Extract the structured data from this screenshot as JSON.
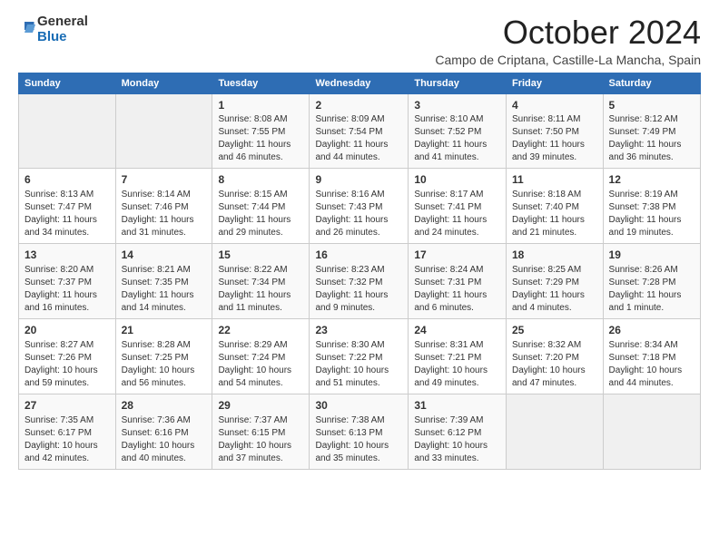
{
  "logo": {
    "line1": "General",
    "line2": "Blue"
  },
  "title": "October 2024",
  "location": "Campo de Criptana, Castille-La Mancha, Spain",
  "days_of_week": [
    "Sunday",
    "Monday",
    "Tuesday",
    "Wednesday",
    "Thursday",
    "Friday",
    "Saturday"
  ],
  "weeks": [
    [
      {
        "day": "",
        "info": ""
      },
      {
        "day": "",
        "info": ""
      },
      {
        "day": "1",
        "info": "Sunrise: 8:08 AM\nSunset: 7:55 PM\nDaylight: 11 hours and 46 minutes."
      },
      {
        "day": "2",
        "info": "Sunrise: 8:09 AM\nSunset: 7:54 PM\nDaylight: 11 hours and 44 minutes."
      },
      {
        "day": "3",
        "info": "Sunrise: 8:10 AM\nSunset: 7:52 PM\nDaylight: 11 hours and 41 minutes."
      },
      {
        "day": "4",
        "info": "Sunrise: 8:11 AM\nSunset: 7:50 PM\nDaylight: 11 hours and 39 minutes."
      },
      {
        "day": "5",
        "info": "Sunrise: 8:12 AM\nSunset: 7:49 PM\nDaylight: 11 hours and 36 minutes."
      }
    ],
    [
      {
        "day": "6",
        "info": "Sunrise: 8:13 AM\nSunset: 7:47 PM\nDaylight: 11 hours and 34 minutes."
      },
      {
        "day": "7",
        "info": "Sunrise: 8:14 AM\nSunset: 7:46 PM\nDaylight: 11 hours and 31 minutes."
      },
      {
        "day": "8",
        "info": "Sunrise: 8:15 AM\nSunset: 7:44 PM\nDaylight: 11 hours and 29 minutes."
      },
      {
        "day": "9",
        "info": "Sunrise: 8:16 AM\nSunset: 7:43 PM\nDaylight: 11 hours and 26 minutes."
      },
      {
        "day": "10",
        "info": "Sunrise: 8:17 AM\nSunset: 7:41 PM\nDaylight: 11 hours and 24 minutes."
      },
      {
        "day": "11",
        "info": "Sunrise: 8:18 AM\nSunset: 7:40 PM\nDaylight: 11 hours and 21 minutes."
      },
      {
        "day": "12",
        "info": "Sunrise: 8:19 AM\nSunset: 7:38 PM\nDaylight: 11 hours and 19 minutes."
      }
    ],
    [
      {
        "day": "13",
        "info": "Sunrise: 8:20 AM\nSunset: 7:37 PM\nDaylight: 11 hours and 16 minutes."
      },
      {
        "day": "14",
        "info": "Sunrise: 8:21 AM\nSunset: 7:35 PM\nDaylight: 11 hours and 14 minutes."
      },
      {
        "day": "15",
        "info": "Sunrise: 8:22 AM\nSunset: 7:34 PM\nDaylight: 11 hours and 11 minutes."
      },
      {
        "day": "16",
        "info": "Sunrise: 8:23 AM\nSunset: 7:32 PM\nDaylight: 11 hours and 9 minutes."
      },
      {
        "day": "17",
        "info": "Sunrise: 8:24 AM\nSunset: 7:31 PM\nDaylight: 11 hours and 6 minutes."
      },
      {
        "day": "18",
        "info": "Sunrise: 8:25 AM\nSunset: 7:29 PM\nDaylight: 11 hours and 4 minutes."
      },
      {
        "day": "19",
        "info": "Sunrise: 8:26 AM\nSunset: 7:28 PM\nDaylight: 11 hours and 1 minute."
      }
    ],
    [
      {
        "day": "20",
        "info": "Sunrise: 8:27 AM\nSunset: 7:26 PM\nDaylight: 10 hours and 59 minutes."
      },
      {
        "day": "21",
        "info": "Sunrise: 8:28 AM\nSunset: 7:25 PM\nDaylight: 10 hours and 56 minutes."
      },
      {
        "day": "22",
        "info": "Sunrise: 8:29 AM\nSunset: 7:24 PM\nDaylight: 10 hours and 54 minutes."
      },
      {
        "day": "23",
        "info": "Sunrise: 8:30 AM\nSunset: 7:22 PM\nDaylight: 10 hours and 51 minutes."
      },
      {
        "day": "24",
        "info": "Sunrise: 8:31 AM\nSunset: 7:21 PM\nDaylight: 10 hours and 49 minutes."
      },
      {
        "day": "25",
        "info": "Sunrise: 8:32 AM\nSunset: 7:20 PM\nDaylight: 10 hours and 47 minutes."
      },
      {
        "day": "26",
        "info": "Sunrise: 8:34 AM\nSunset: 7:18 PM\nDaylight: 10 hours and 44 minutes."
      }
    ],
    [
      {
        "day": "27",
        "info": "Sunrise: 7:35 AM\nSunset: 6:17 PM\nDaylight: 10 hours and 42 minutes."
      },
      {
        "day": "28",
        "info": "Sunrise: 7:36 AM\nSunset: 6:16 PM\nDaylight: 10 hours and 40 minutes."
      },
      {
        "day": "29",
        "info": "Sunrise: 7:37 AM\nSunset: 6:15 PM\nDaylight: 10 hours and 37 minutes."
      },
      {
        "day": "30",
        "info": "Sunrise: 7:38 AM\nSunset: 6:13 PM\nDaylight: 10 hours and 35 minutes."
      },
      {
        "day": "31",
        "info": "Sunrise: 7:39 AM\nSunset: 6:12 PM\nDaylight: 10 hours and 33 minutes."
      },
      {
        "day": "",
        "info": ""
      },
      {
        "day": "",
        "info": ""
      }
    ]
  ]
}
